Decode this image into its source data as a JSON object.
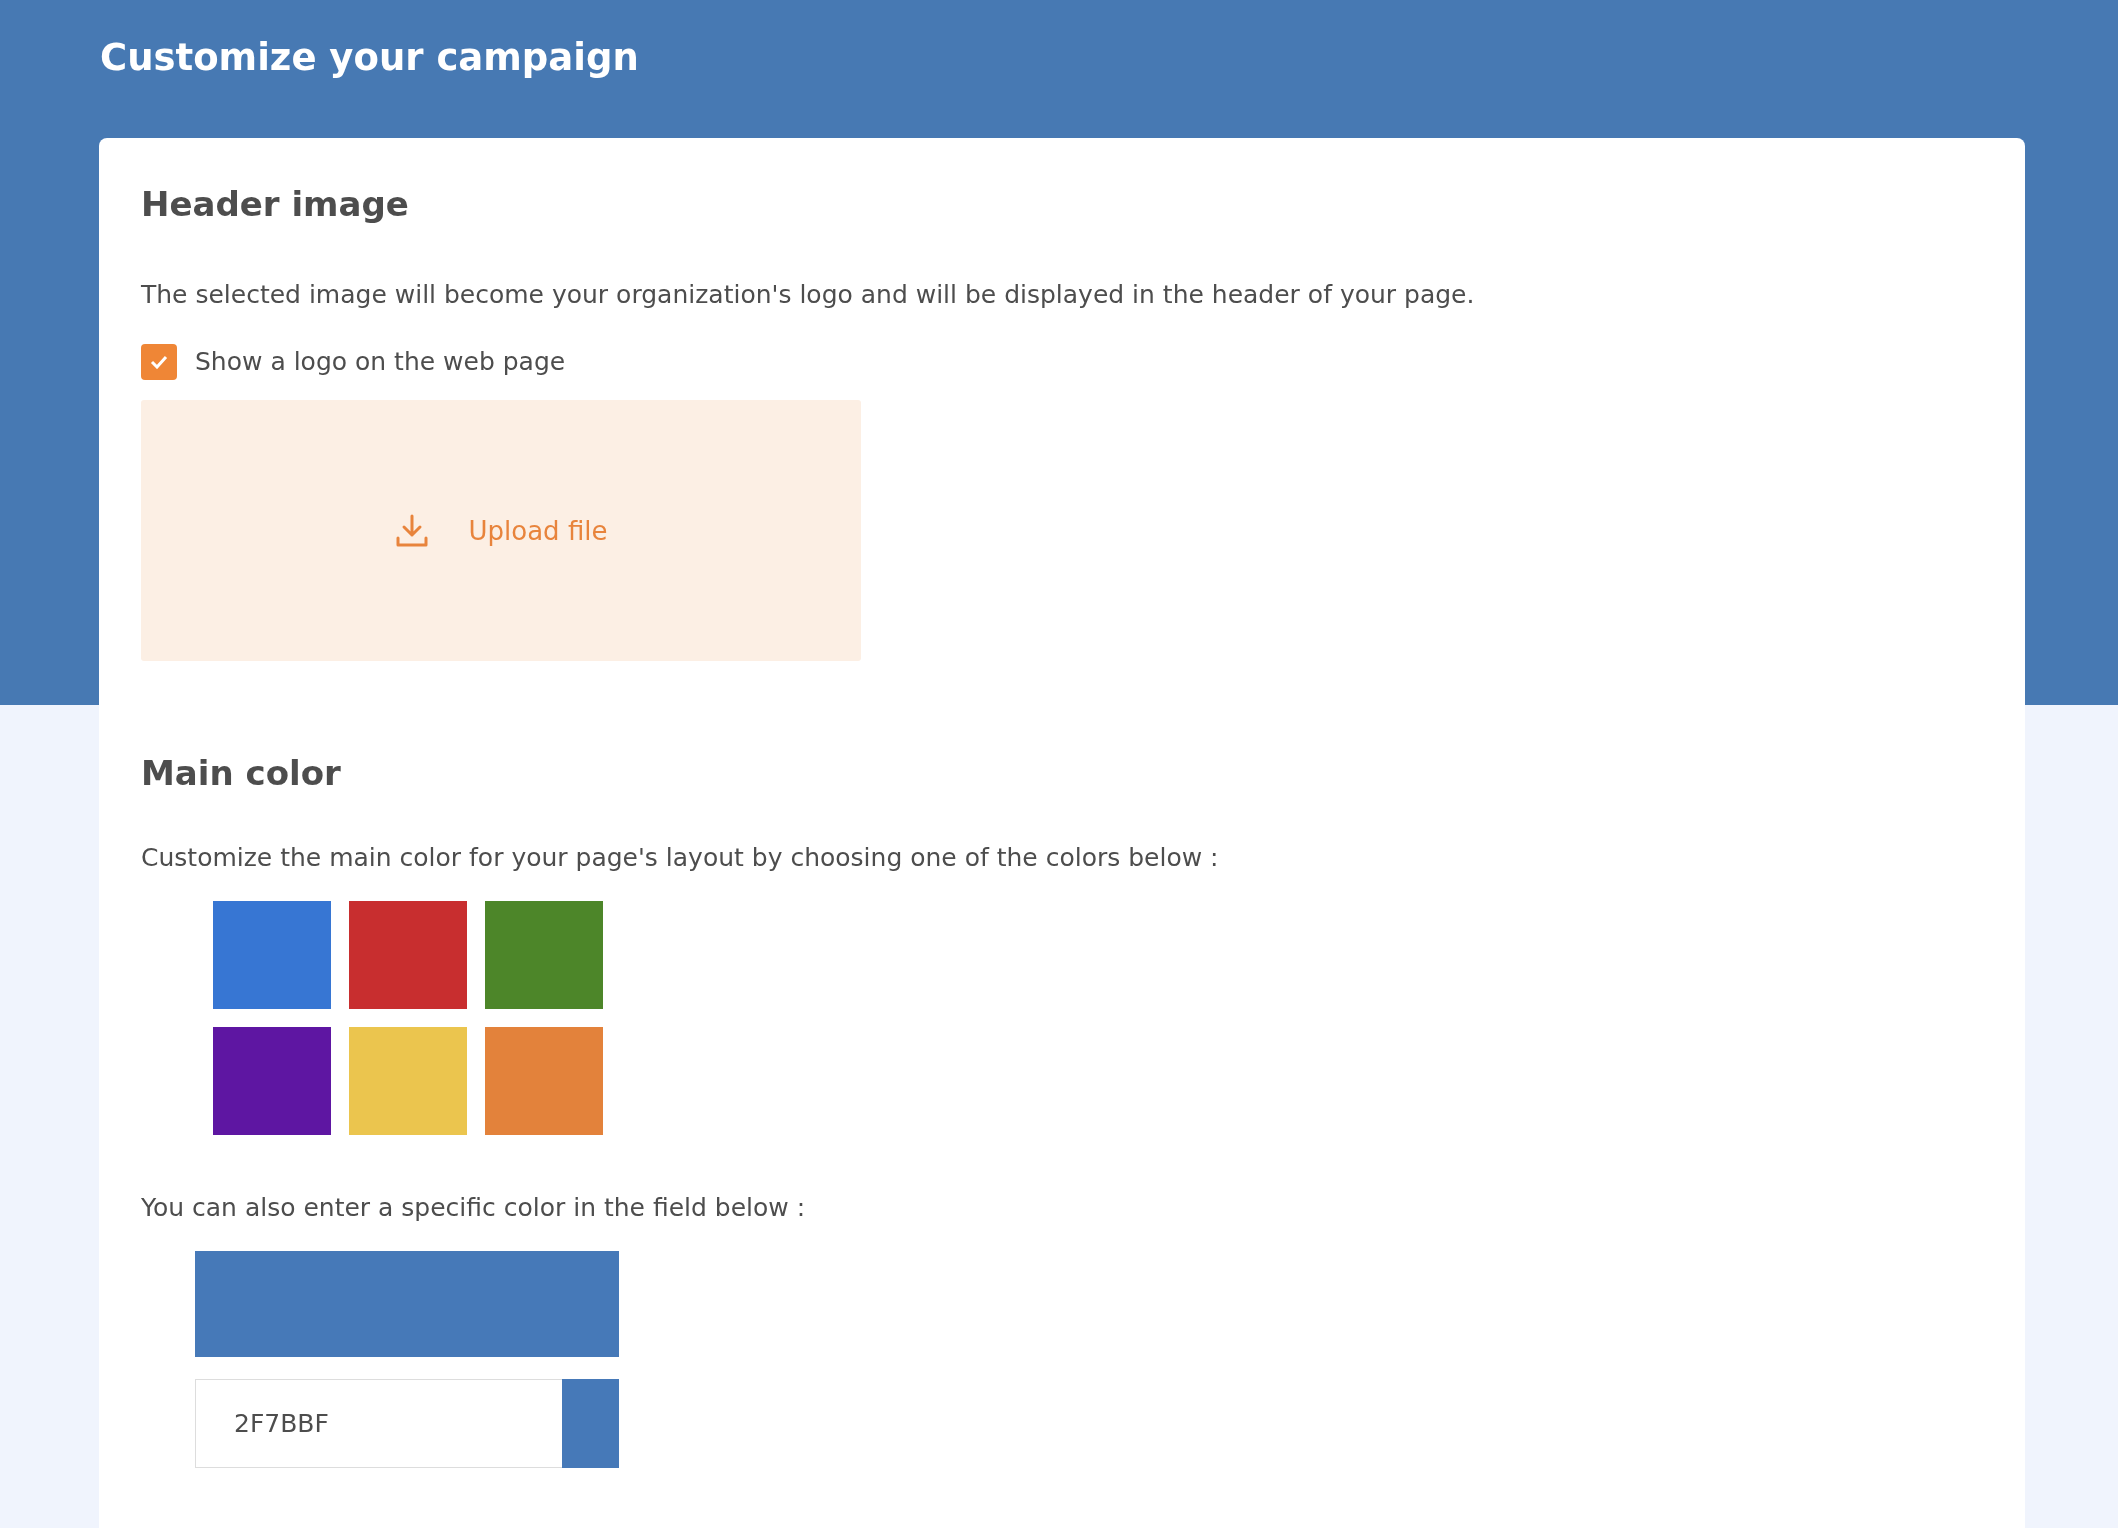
{
  "page": {
    "title": "Customize your campaign"
  },
  "header_image": {
    "heading": "Header image",
    "description": "The selected image will become your organization's logo and will be displayed in the header of your page.",
    "show_logo": {
      "label": "Show a logo on the web page",
      "checked": true
    },
    "upload": {
      "label": "Upload file"
    }
  },
  "main_color": {
    "heading": "Main color",
    "description": "Customize the main color for your page's layout by choosing one of the colors below :",
    "swatches": [
      {
        "color": "#3776d3"
      },
      {
        "color": "#c82e2f"
      },
      {
        "color": "#4d8629"
      },
      {
        "color": "#5e16a2"
      },
      {
        "color": "#ebc54e"
      },
      {
        "color": "#e3823b"
      }
    ],
    "custom_hint": "You can also enter a specific color in the field below :",
    "custom_color": {
      "value": "2F7BBF",
      "color": "#4679b8"
    }
  }
}
